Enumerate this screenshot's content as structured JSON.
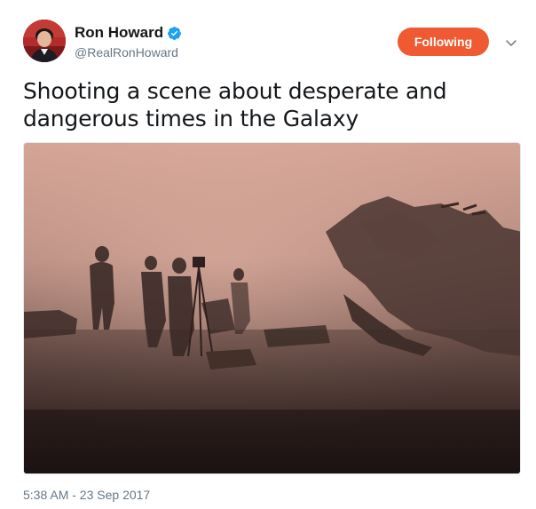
{
  "tweet": {
    "author": {
      "display_name": "Ron Howard",
      "handle": "@RealRonHoward",
      "verified": true
    },
    "follow_button_label": "Following",
    "text": "Shooting a scene about desperate and dangerous times in the Galaxy",
    "timestamp": "5:38 AM - 23 Sep 2017"
  },
  "colors": {
    "follow_button": "#ef5a33",
    "verified_badge": "#1da1f2",
    "secondary_text": "#657786",
    "primary_text": "#14171a"
  },
  "icons": {
    "verified": "verified-badge-icon",
    "menu": "chevron-down-icon"
  }
}
